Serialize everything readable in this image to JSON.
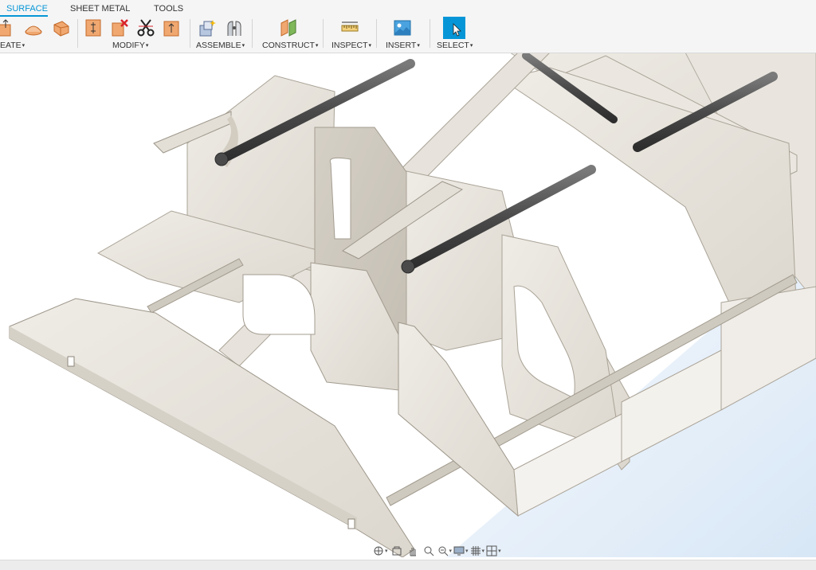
{
  "tabs": [
    {
      "label": "SURFACE",
      "active": true
    },
    {
      "label": "SHEET METAL",
      "active": false
    },
    {
      "label": "TOOLS",
      "active": false
    }
  ],
  "groups": {
    "create": "EATE",
    "modify": "MODIFY",
    "assemble": "ASSEMBLE",
    "construct": "CONSTRUCT",
    "inspect": "INSPECT",
    "insert": "INSERT",
    "select": "SELECT"
  },
  "caret": "▾",
  "tools": {
    "create": [
      "extrude-icon",
      "loft-icon",
      "patch-icon"
    ],
    "modify": [
      "offset-face-icon",
      "delete-icon",
      "split-icon",
      "press-pull-icon"
    ],
    "assemble": [
      "new-component-icon",
      "joint-icon"
    ],
    "construct": [
      "offset-plane-icon"
    ],
    "inspect": [
      "measure-icon"
    ],
    "insert": [
      "insert-image-icon"
    ],
    "select": [
      "select-icon"
    ]
  },
  "navbar": [
    "orbit-icon",
    "look-at-icon",
    "pan-icon",
    "zoom-icon",
    "fit-icon",
    "display-settings-icon",
    "grid-icon",
    "viewports-icon"
  ],
  "colors": {
    "accent": "#0696d7",
    "plywood": "#e6e2da",
    "plywood_shadow": "#cfcac0",
    "rod": "#5a5a5a",
    "select_blue": "#0696d7",
    "tool_orange": "#f0a870"
  }
}
